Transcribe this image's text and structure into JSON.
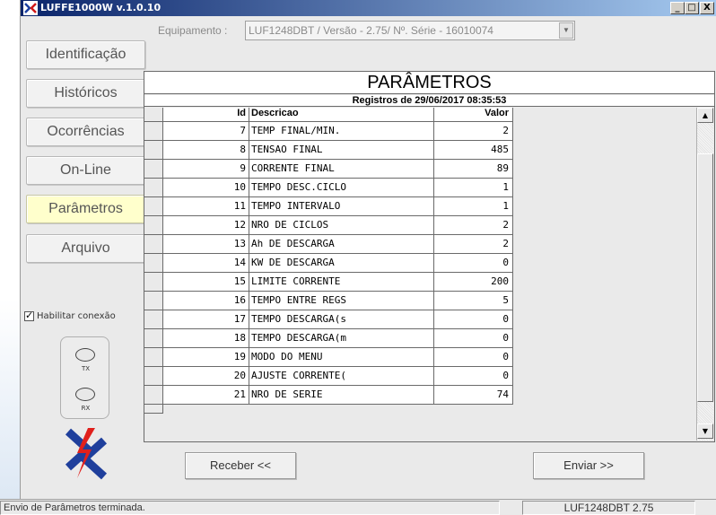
{
  "window": {
    "title": "LUFFE1000W v.1.0.10",
    "min_label": "_",
    "max_label": "□",
    "close_label": "X"
  },
  "nav": {
    "items": [
      {
        "label": "Identificação",
        "active": false
      },
      {
        "label": "Históricos",
        "active": false
      },
      {
        "label": "Ocorrências",
        "active": false
      },
      {
        "label": "On-Line",
        "active": false
      },
      {
        "label": "Parâmetros",
        "active": true
      },
      {
        "label": "Arquivo",
        "active": false
      }
    ],
    "habilitar_label": "Habilitar conexão",
    "habilitar_checked": true,
    "tx_label": "TX",
    "rx_label": "RX"
  },
  "equipment": {
    "label": "Equipamento :",
    "value": "LUF1248DBT / Versão - 2.75/ Nº. Série - 16010074"
  },
  "parametros": {
    "title": "PARÂMETROS",
    "subtitle": "Registros de 29/06/2017 08:35:53",
    "columns": {
      "id": "Id",
      "desc": "Descricao",
      "val": "Valor"
    },
    "rows": [
      {
        "id": "7",
        "desc": "TEMP FINAL/MIN.",
        "val": "2"
      },
      {
        "id": "8",
        "desc": "TENSAO FINAL",
        "val": "485"
      },
      {
        "id": "9",
        "desc": "CORRENTE FINAL",
        "val": "89"
      },
      {
        "id": "10",
        "desc": "TEMPO DESC.CICLO",
        "val": "1"
      },
      {
        "id": "11",
        "desc": "TEMPO INTERVALO",
        "val": "1"
      },
      {
        "id": "12",
        "desc": "NRO DE CICLOS",
        "val": "2"
      },
      {
        "id": "13",
        "desc": "Ah DE DESCARGA",
        "val": "2"
      },
      {
        "id": "14",
        "desc": "KW DE DESCARGA",
        "val": "0"
      },
      {
        "id": "15",
        "desc": "LIMITE CORRENTE",
        "val": "200"
      },
      {
        "id": "16",
        "desc": "TEMPO ENTRE REGS",
        "val": "5"
      },
      {
        "id": "17",
        "desc": "TEMPO DESCARGA(s",
        "val": "0"
      },
      {
        "id": "18",
        "desc": "TEMPO DESCARGA(m",
        "val": "0"
      },
      {
        "id": "19",
        "desc": "MODO DO MENU",
        "val": "0"
      },
      {
        "id": "20",
        "desc": "AJUSTE CORRENTE(",
        "val": "0"
      },
      {
        "id": "21",
        "desc": "NRO DE SERIE",
        "val": "74"
      }
    ]
  },
  "actions": {
    "receber": "Receber <<",
    "enviar": "Enviar >>"
  },
  "status": {
    "message": "Envio de Parâmetros terminada.",
    "device": "LUF1248DBT 2.75"
  },
  "colors": {
    "titlebar_start": "#0a246a",
    "titlebar_end": "#a6caf0",
    "active_nav": "#ffffcc"
  }
}
